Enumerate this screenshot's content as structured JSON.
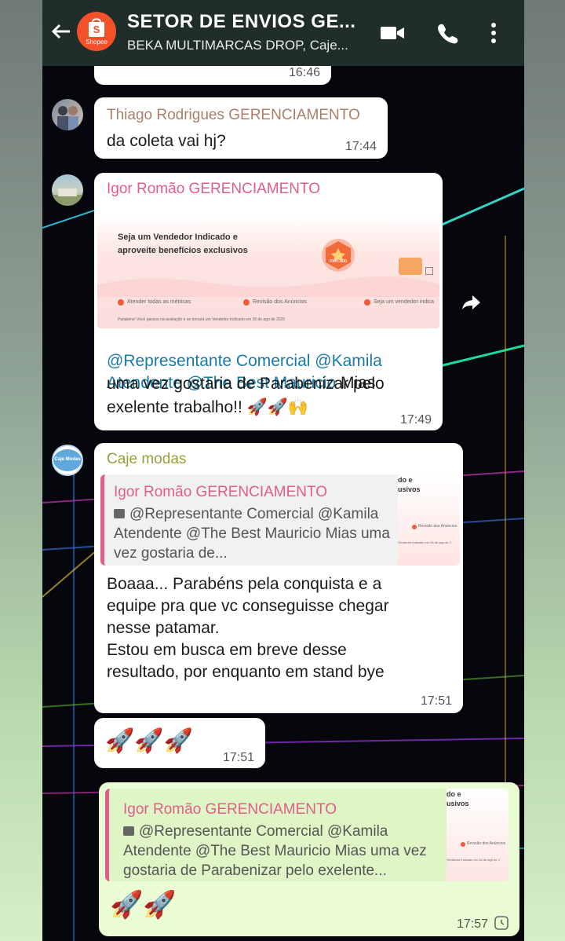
{
  "header": {
    "title": "SETOR DE ENVIOS GE...",
    "subtitle": "BEKA MULTIMARCAS DROP, Caje...",
    "avatar_label": "Shopee",
    "avatar_letter": "S"
  },
  "messages": {
    "partial": {
      "time": "16:46"
    },
    "m1": {
      "sender": "Thiago Rodrigues GERENCIAMENTO",
      "text": "da coleta vai hj?",
      "time": "17:44"
    },
    "m2": {
      "sender": "Igor Romão GERENCIAMENTO",
      "preview": {
        "line1": "Seja um Vendedor Indicado e",
        "line2": "aproveite benefícios exclusivos",
        "step1": "Atender todas as métricas",
        "step2": "Revisão dos Anúncios",
        "step3": "Seja um vendedor indica",
        "note": "Parabéns! Você passou na avaliação e se tornará um Vendedor Indicado em 28 de ago de 2025",
        "badge": "Indicado"
      },
      "mention1": "@Representante Comercial",
      "mention2": "@Kamila",
      "mention3": "Atendente",
      "mention4": "@The Best Mauricio",
      "text_after": "Mias",
      "text_rest": "uma vez gostaria de Parabenizar pelo\nexelente trabalho!! 🚀🚀🙌",
      "time": "17:49"
    },
    "m3": {
      "sender": "Caje modas",
      "avatar_label": "Caje Modas",
      "quote_sender": "Igor Romão GERENCIAMENTO",
      "quote_text": "@Representante Comercial @Kamila Atendente @The Best Mauricio  Mias uma vez gostaria de...",
      "quote_thumb_1": "do e",
      "quote_thumb_2": "usivos",
      "quote_thumb_3": "Revisão dos Anúncios",
      "quote_thumb_4": "Vendedor Indicado em 28 de ago de 2",
      "text": "Boaaa... Parabéns pela conquista e a\nequipe pra que vc conseguisse chegar\nnesse patamar.\nEstou em busca em breve desse\nresultado, por enquanto em stand bye",
      "time": "17:51"
    },
    "m4": {
      "text": "🚀🚀🚀",
      "time": "17:51"
    },
    "m5": {
      "quote_sender": "Igor Romão GERENCIAMENTO",
      "quote_text": "@Representante Comercial @Kamila Atendente @The Best Mauricio  Mias uma vez gostaria de Parabenizar pelo exelente...",
      "quote_thumb_1": "do e",
      "quote_thumb_2": "usivos",
      "quote_thumb_3": "Revisão dos Anúncios",
      "quote_thumb_4": "Vendedor Indicado em 28 de ago de 2",
      "text": "🚀🚀",
      "time": "17:57"
    }
  },
  "colors": {
    "header": "#1f2d2b",
    "sender_thiago": "#a9806a",
    "sender_igor": "#e05e8a",
    "sender_caje": "#9aa03a",
    "mention": "#1a7aa3",
    "outgoing_bubble": "#e9fcd3"
  }
}
